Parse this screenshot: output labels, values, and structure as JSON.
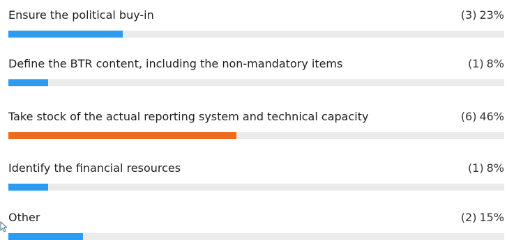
{
  "colors": {
    "bar": "#2d9bf0",
    "top_bar": "#f06a1d",
    "track": "#ebebeb"
  },
  "options": [
    {
      "label": "Ensure the political buy-in",
      "count": "(3)",
      "percent": "23%",
      "value": 23,
      "top": false
    },
    {
      "label": "Define the BTR content, including the non-mandatory items",
      "count": "(1)",
      "percent": "8%",
      "value": 8,
      "top": false
    },
    {
      "label": "Take stock of the actual reporting system and technical capacity",
      "count": "(6)",
      "percent": "46%",
      "value": 46,
      "top": true
    },
    {
      "label": "Identify the financial resources",
      "count": "(1)",
      "percent": "8%",
      "value": 8,
      "top": false
    },
    {
      "label": "Other",
      "count": "(2)",
      "percent": "15%",
      "value": 15,
      "top": false
    }
  ]
}
